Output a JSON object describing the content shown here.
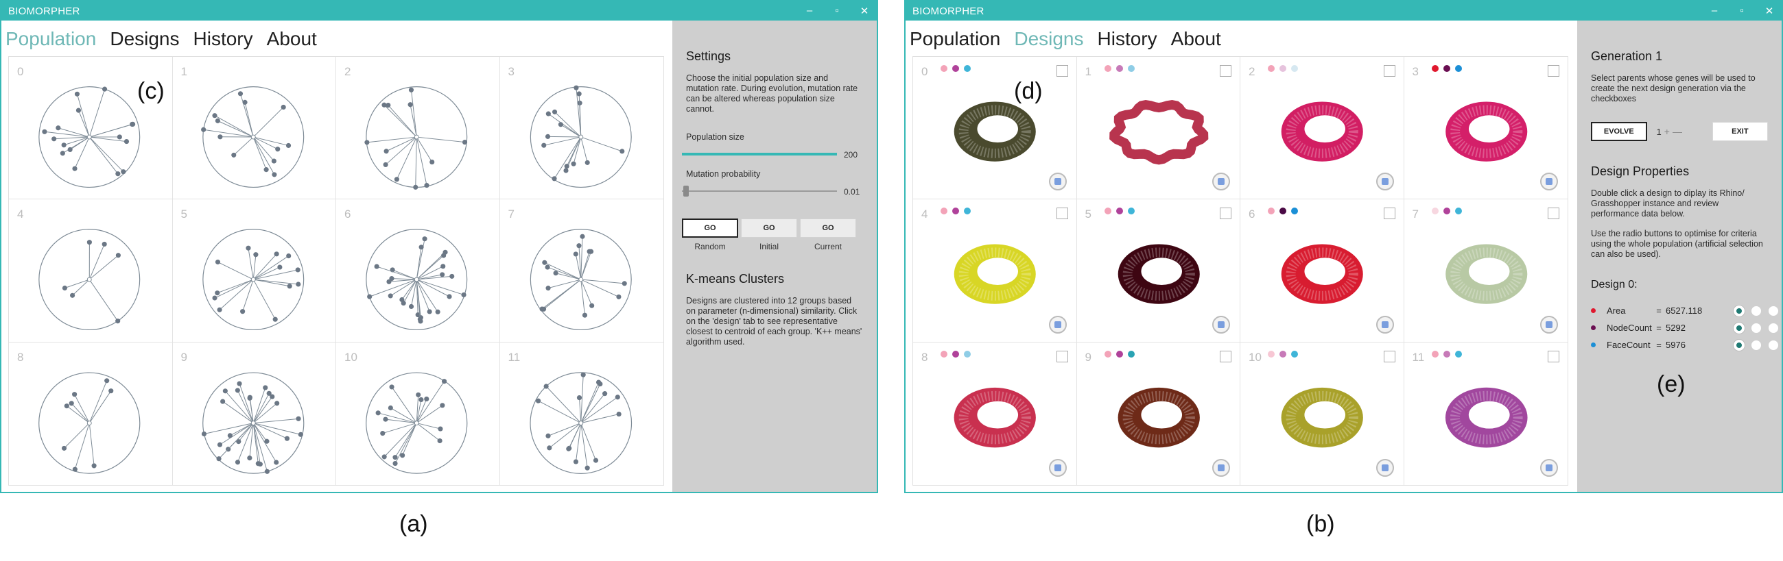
{
  "windows": [
    {
      "id": "population",
      "app_title": "BIOMORPHER",
      "menu": [
        "Population",
        "Designs",
        "History",
        "About"
      ],
      "active_menu": 0,
      "grid_letter": "(c)",
      "cells": [
        {
          "index": "0",
          "n": 16,
          "seed": 1
        },
        {
          "index": "1",
          "n": 13,
          "seed": 2
        },
        {
          "index": "2",
          "n": 12,
          "seed": 3
        },
        {
          "index": "3",
          "n": 14,
          "seed": 4
        },
        {
          "index": "4",
          "n": 6,
          "seed": 5
        },
        {
          "index": "5",
          "n": 14,
          "seed": 6
        },
        {
          "index": "6",
          "n": 24,
          "seed": 7
        },
        {
          "index": "7",
          "n": 15,
          "seed": 8
        },
        {
          "index": "8",
          "n": 8,
          "seed": 9
        },
        {
          "index": "9",
          "n": 26,
          "seed": 10
        },
        {
          "index": "10",
          "n": 16,
          "seed": 11
        },
        {
          "index": "11",
          "n": 16,
          "seed": 12
        }
      ],
      "settings": {
        "title": "Settings",
        "description": "Choose the initial population size and mutation rate. During evolution, mutation rate can be altered whereas population size cannot.",
        "pop_size_label": "Population size",
        "pop_size_value": "200",
        "pop_size_fraction": 1.0,
        "mutation_label": "Mutation probability",
        "mutation_value": "0.01",
        "mutation_fraction": 0.01,
        "go_buttons": [
          {
            "label": "GO",
            "caption": "Random",
            "selected": true
          },
          {
            "label": "GO",
            "caption": "Initial",
            "selected": false
          },
          {
            "label": "GO",
            "caption": "Current",
            "selected": false
          }
        ]
      },
      "kmeans": {
        "title": "K-means Clusters",
        "description": "Designs are clustered into 12 groups based on parameter (n-dimensional) similarity. Click on the 'design' tab to see representative closest to centroid of each group. 'K++ means' algorithm used."
      },
      "caption": "(a)"
    },
    {
      "id": "designs",
      "app_title": "BIOMORPHER",
      "menu": [
        "Population",
        "Designs",
        "History",
        "About"
      ],
      "active_menu": 1,
      "grid_letter": "(d)",
      "cells": [
        {
          "index": "0",
          "color": "#4a4a2e",
          "dots": [
            "#f3a3b8",
            "#b0429a",
            "#3fb5d8"
          ]
        },
        {
          "index": "1",
          "color": "#b8344e",
          "dots": [
            "#f3a3b8",
            "#c77ab8",
            "#8fcde6"
          ],
          "wavy": true
        },
        {
          "index": "2",
          "color": "#d21e63",
          "dots": [
            "#f3a3b8",
            "#e6c3dd",
            "#d6e8f1"
          ]
        },
        {
          "index": "3",
          "color": "#d41f69",
          "dots": [
            "#e0182e",
            "#6a0e52",
            "#1b8fd6"
          ]
        },
        {
          "index": "4",
          "color": "#d8d625",
          "dots": [
            "#f3a3b8",
            "#b0429a",
            "#3fb5d8"
          ]
        },
        {
          "index": "5",
          "color": "#3e0612",
          "dots": [
            "#f3a3b8",
            "#b0429a",
            "#3fb5d8"
          ]
        },
        {
          "index": "6",
          "color": "#d81c30",
          "dots": [
            "#f3a3b8",
            "#4a0a45",
            "#1b8fd6"
          ]
        },
        {
          "index": "7",
          "color": "#b8c9a4",
          "dots": [
            "#f7d7e0",
            "#b0429a",
            "#3fb5d8"
          ]
        },
        {
          "index": "8",
          "color": "#c9304f",
          "dots": [
            "#f3a3b8",
            "#b0429a",
            "#8fcde6"
          ]
        },
        {
          "index": "9",
          "color": "#6e2a18",
          "dots": [
            "#f3a3b8",
            "#b0429a",
            "#2aa3b3"
          ]
        },
        {
          "index": "10",
          "color": "#a9a12a",
          "dots": [
            "#f7c7d4",
            "#c77ab8",
            "#3fb5d8"
          ]
        },
        {
          "index": "11",
          "color": "#a1479e",
          "dots": [
            "#f3a3b8",
            "#c77ab8",
            "#3fb5d8"
          ]
        }
      ],
      "generation": {
        "title": "Generation 1",
        "description": "Select parents whose genes will be used to create the next design generation via the checkboxes",
        "evolve_label": "EVOLVE",
        "stepper_value": "1",
        "exit_label": "EXIT"
      },
      "properties": {
        "title": "Design Properties",
        "description1": "Double click a design to diplay its Rhino/ Grasshopper instance and review performance data below.",
        "description2": "Use the radio buttons to optimise for criteria using the whole population (artificial selection can also be used).",
        "design_title": "Design 0:",
        "metrics": [
          {
            "name": "Area",
            "value": "6527.118",
            "color": "#e0182e"
          },
          {
            "name": "NodeCount",
            "value": "5292",
            "color": "#6a0e52"
          },
          {
            "name": "FaceCount",
            "value": "5976",
            "color": "#1b8fd6"
          }
        ],
        "panel_letter": "(e)"
      },
      "caption": "(b)"
    }
  ],
  "colors": {
    "accent": "#35b8b5",
    "panel": "#cfcfcf",
    "biomorph_stroke": "#7e8b96",
    "biomorph_dot": "#6b7785"
  }
}
